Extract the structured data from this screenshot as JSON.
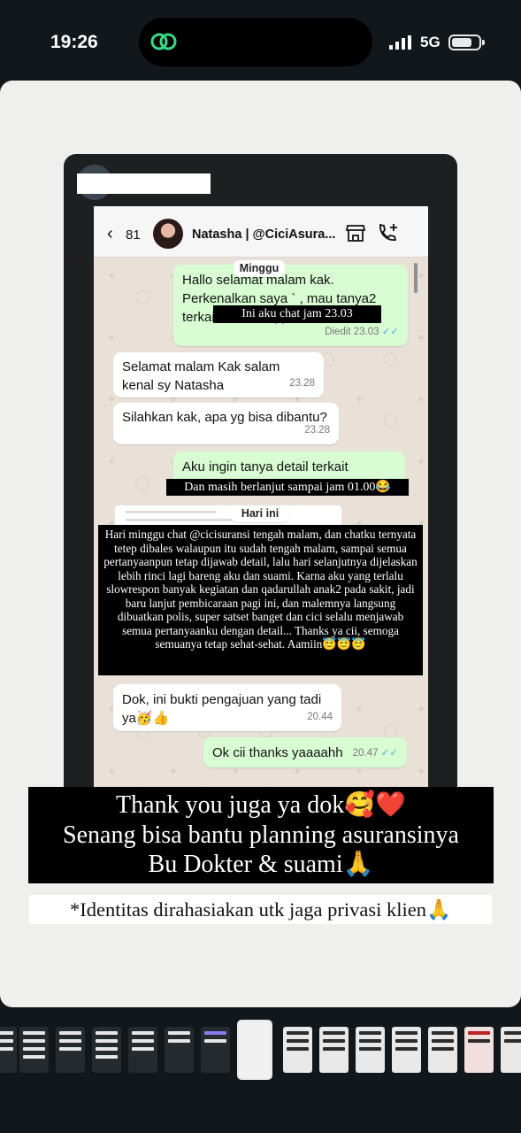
{
  "status_bar": {
    "time": "19:26",
    "network": "5G"
  },
  "chat": {
    "back_count": "81",
    "contact_name": "Natasha | @CiciAsura...",
    "day_label_1": "Minggu",
    "day_label_2": "Hari ini",
    "messages": [
      {
        "dir": "out",
        "text": "Hallo selamat malam kak. Perkenalkan saya `      , mau tanya2 terkait as                         h kak🙏🏻",
        "time": "Diedit 23.03"
      },
      {
        "dir": "in",
        "text": "Selamat malam Kak          salam kenal sy Natasha",
        "time": "23.28"
      },
      {
        "dir": "in",
        "text": "Silahkan kak, apa yg bisa dibantu?",
        "time": "23.28"
      },
      {
        "dir": "out",
        "text": "Aku ingin tanya detail terkait",
        "time": ""
      },
      {
        "dir": "in",
        "text": "Dok, ini bukti pengajuan yang tadi ya🥳👍",
        "time": "20.44"
      },
      {
        "dir": "out",
        "text": "Ok cii thanks yaaaahh",
        "time": "20.47"
      }
    ],
    "annotation_1": "Ini aku chat jam 23.03",
    "annotation_2": "Dan masih berlanjut sampai jam 01.00😂",
    "annotation_3": "Hari minggu chat @cicisuransi tengah malam, dan chatku ternyata tetep dibales walaupun itu sudah tengah malam, sampai semua pertanyaanpun tetap dijawab detail, lalu hari selanjutnya dijelaskan lebih rinci lagi bareng aku dan suami. Karna aku yang terlalu slowrespon banyak kegiatan dan qadarullah anak2 pada sakit, jadi baru lanjut pembicaraan pagi ini, dan malemnya langsung dibuatkan polis, super satset banget dan cici selalu menjawab semua pertanyaanku dengan detail... Thanks ya cii, semoga semuanya tetap sehat-sehat. Aamiin😇😇😇"
  },
  "story": {
    "big_caption": "Thank you juga ya dok🥰❤️\nSenang bisa bantu planning asuransinya\nBu Dokter & suami🙏",
    "note": "*Identitas dirahasiakan utk jaga privasi klien🙏"
  },
  "icons": [
    "orbit-link-icon",
    "signal-icon",
    "battery-icon",
    "back-chevron-icon",
    "store-icon",
    "call-add-icon",
    "read-check-icon"
  ]
}
